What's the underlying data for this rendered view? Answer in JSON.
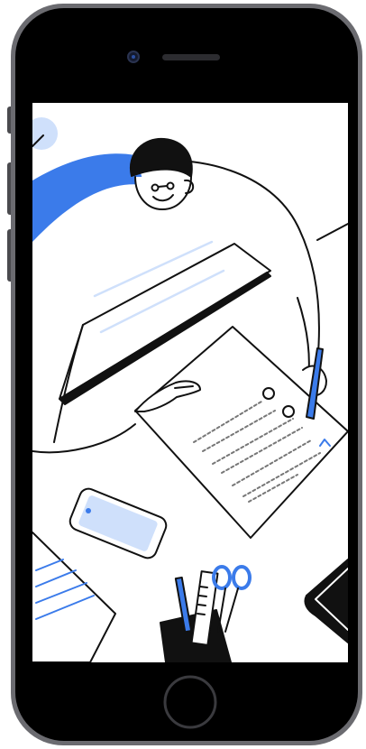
{
  "device": {
    "type": "smartphone",
    "frame_color": "#2b2b2e",
    "bezel_color": "#000000",
    "screen_background": "#ffffff"
  },
  "illustration": {
    "subject": "person-writing-at-desk",
    "accent_color": "#3b7bea",
    "light_accent_color": "#cfe0fb",
    "line_color": "#111111",
    "icons": [
      "person-icon",
      "laptop-icon",
      "document-icon",
      "pen-icon",
      "phone-icon",
      "pencil-cup-icon",
      "scissors-icon",
      "ruler-icon"
    ]
  }
}
